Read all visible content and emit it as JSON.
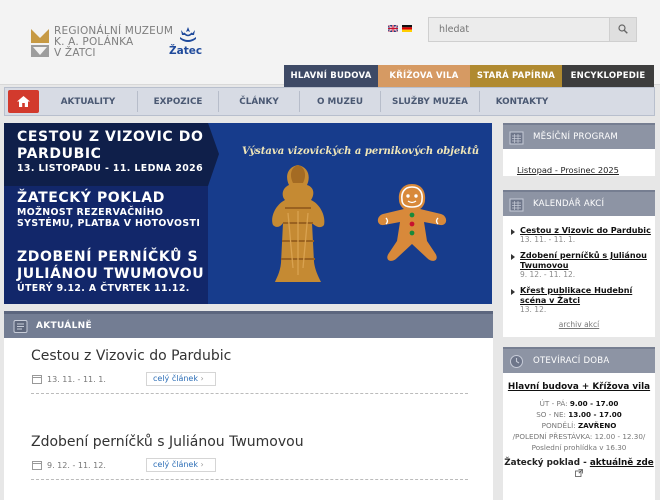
{
  "header": {
    "logo_line1": "REGIONÁLNÍ MUZEUM",
    "logo_line2": "K. A. POLÁNKA",
    "logo_line3": "V ŽATCI",
    "town_name": "Žatec",
    "search_placeholder": "hledat"
  },
  "building_tabs": [
    {
      "label": "HLAVNÍ BUDOVA",
      "color": "#3e4a66"
    },
    {
      "label": "KŘÍŽOVA VILA",
      "color": "#d69a63"
    },
    {
      "label": "STARÁ PAPÍRNA",
      "color": "#b08a30"
    },
    {
      "label": "ENCYKLOPEDIE",
      "color": "#3d3d3d"
    }
  ],
  "nav": {
    "home_icon": "home-icon",
    "items": [
      "AKTUALITY",
      "EXPOZICE",
      "ČLÁNKY",
      "O MUZEU",
      "SLUŽBY MUZEA",
      "KONTAKTY"
    ]
  },
  "slider": {
    "items": [
      {
        "title": "CESTOU Z VIZOVIC DO PARDUBIC",
        "sub": "13. LISTOPADU - 11. LEDNA 2026"
      },
      {
        "title": "ŽATECKÝ POKLAD",
        "sub": "MOŽNOST REZERVAČNÍHO SYSTÉMU, PLATBA V HOTOVOSTI"
      },
      {
        "title": "ZDOBENÍ PERNÍČKŮ S JULIÁNOU TWUMOVOU",
        "sub": "ÚTERÝ 9.12. A ČTVRTEK 11.12."
      }
    ],
    "caption": "Výstava vizovických a pernikových objektů"
  },
  "aktualne": {
    "title": "AKTUÁLNĚ",
    "articles": [
      {
        "title": "Cestou z Vizovic do Pardubic",
        "date": "13. 11. - 11. 1.",
        "more": "celý článek"
      },
      {
        "title": "Zdobení perníčků s Juliánou Twumovou",
        "date": "9. 12. - 11. 12.",
        "more": "celý článek"
      }
    ]
  },
  "sidebar": {
    "program": {
      "title": "MĚSÍČNÍ PROGRAM",
      "link": "Listopad - Prosinec 2025"
    },
    "events": {
      "title": "KALENDÁŘ AKCÍ",
      "items": [
        {
          "title": "Cestou z Vizovic do Pardubic",
          "date": "13. 11. - 11. 1."
        },
        {
          "title": "Zdobení perníčků s Juliánou Twumovou",
          "date": "9. 12. - 11. 12."
        },
        {
          "title": "Křest publikace Hudební scéna v Žatci",
          "date": "13. 12."
        }
      ],
      "archive": "archiv akcí"
    },
    "hours": {
      "title": "OTEVÍRACÍ DOBA",
      "building": "Hlavní budova + Křížova vila",
      "rows": [
        {
          "label": "ÚT - PÁ:",
          "value": "9.00 - 17.00"
        },
        {
          "label": "SO - NE:",
          "value": "13.00 - 17.00"
        },
        {
          "label": "PONDĚLÍ:",
          "value": "ZAVŘENO"
        }
      ],
      "pause": "/POLEDNÍ PŘESTÁVKA: 12.00 - 12.30/",
      "last_tour": "Poslední prohlídka v 16.30",
      "treasure_prefix": "Žatecký poklad -",
      "treasure_link": "aktuálně zde"
    }
  }
}
